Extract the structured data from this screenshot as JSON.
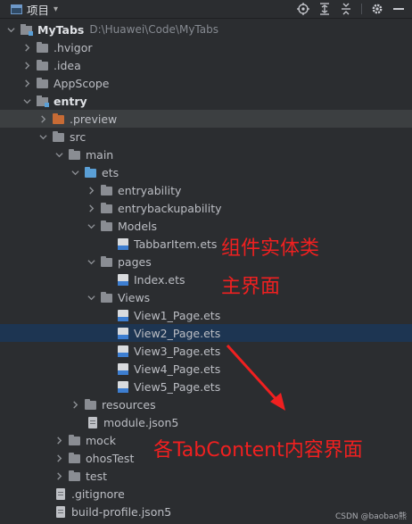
{
  "toolbar": {
    "project_label": "项目",
    "icons": [
      "crosshair-icon",
      "expand-all-icon",
      "collapse-all-icon",
      "gear-icon",
      "hide-icon"
    ]
  },
  "tree": {
    "root": {
      "name": "MyTabs",
      "path": "D:\\Huawei\\Code\\MyTabs"
    },
    "hvigor": ".hvigor",
    "idea": ".idea",
    "appscope": "AppScope",
    "entry": "entry",
    "preview": ".preview",
    "src": "src",
    "main": "main",
    "ets": "ets",
    "entryability": "entryability",
    "entrybackupability": "entrybackupability",
    "models": "Models",
    "tabbaritem": "TabbarItem.ets",
    "pages": "pages",
    "index": "Index.ets",
    "views": "Views",
    "view1": "View1_Page.ets",
    "view2": "View2_Page.ets",
    "view3": "View3_Page.ets",
    "view4": "View4_Page.ets",
    "view5": "View5_Page.ets",
    "resources": "resources",
    "modulejson": "module.json5",
    "mock": "mock",
    "ohostest": "ohosTest",
    "test": "test",
    "gitignore": ".gitignore",
    "buildprofile": "build-profile.json5"
  },
  "annotations": {
    "component_entity": "组件实体类",
    "main_ui": "主界面",
    "tab_content": "各TabContent内容界面"
  },
  "watermark": "CSDN @baobao熊",
  "colors": {
    "annotation": "#f02020",
    "selected_row": "#1d3552",
    "background": "#2b2d30"
  }
}
